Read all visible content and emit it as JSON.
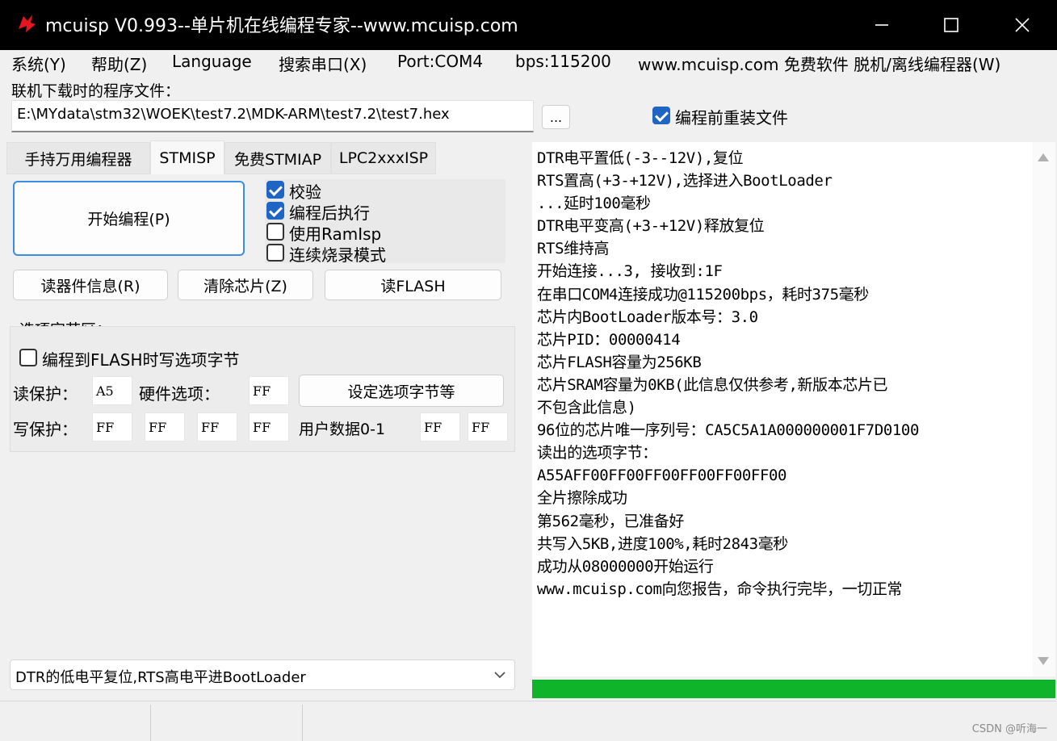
{
  "window": {
    "title": "mcuisp V0.993--单片机在线编程专家--www.mcuisp.com",
    "colors": {
      "titlebar": "#000000",
      "accent": "#1f66c4",
      "progress": "#10b42a"
    }
  },
  "menu": {
    "system": "系统(Y)",
    "help": "帮助(Z)",
    "language": "Language",
    "search_port": "搜索串口(X)",
    "port": "Port:COM4",
    "bps": "bps:115200",
    "website": "www.mcuisp.com 免费软件 脱机/离线编程器(W)"
  },
  "file": {
    "label": "联机下载时的程序文件：",
    "path": "E:\\MYdata\\stm32\\WOEK\\test7.2\\MDK-ARM\\test7.2\\test7.hex",
    "browse": "...",
    "reload_label": "编程前重装文件",
    "reload_checked": true
  },
  "tabs": [
    "手持万用编程器",
    "STMISP",
    "免费STMIAP",
    "LPC2xxxISP"
  ],
  "stmisp": {
    "start_button": "开始编程(P)",
    "verify": "校验",
    "run_after": "编程后执行",
    "use_ramisp": "使用RamIsp",
    "continuous": "连续烧录模式",
    "read_info": "读器件信息(R)",
    "erase": "清除芯片(Z)",
    "read_flash": "读FLASH"
  },
  "options": {
    "group_title": "选项字节区：",
    "write_option": "编程到FLASH时写选项字节",
    "read_protect_label": "读保护：",
    "read_protect_value": "A5",
    "hw_option_label": "硬件选项：",
    "hw_option_value": "FF",
    "set_option_button": "设定选项字节等",
    "write_protect_label": "写保护：",
    "write_protect_values": [
      "FF",
      "FF",
      "FF",
      "FF"
    ],
    "user_data_label": "用户数据0-1",
    "user_data_values": [
      "FF",
      "FF"
    ]
  },
  "reset_mode": {
    "selected": "DTR的低电平复位,RTS高电平进BootLoader"
  },
  "log": [
    "DTR电平置低(-3--12V),复位",
    "RTS置高(+3-+12V),选择进入BootLoader",
    "...延时100毫秒",
    "DTR电平变高(+3-+12V)释放复位",
    "RTS维持高",
    "开始连接...3, 接收到:1F",
    "在串口COM4连接成功@115200bps，耗时375毫秒",
    "芯片内BootLoader版本号：3.0",
    "芯片PID：00000414",
    "芯片FLASH容量为256KB",
    "芯片SRAM容量为0KB(此信息仅供参考,新版本芯片已",
    "不包含此信息)",
    "96位的芯片唯一序列号：CA5C5A1A000000001F7D0100",
    "读出的选项字节：",
    "A55AFF00FF00FF00FF00FF00FF00",
    "全片擦除成功",
    "第562毫秒，已准备好",
    "共写入5KB,进度100%,耗时2843毫秒",
    "成功从08000000开始运行",
    "www.mcuisp.com向您报告，命令执行完毕，一切正常"
  ],
  "progress_fraction": 1.0,
  "watermark": "CSDN @听海一"
}
